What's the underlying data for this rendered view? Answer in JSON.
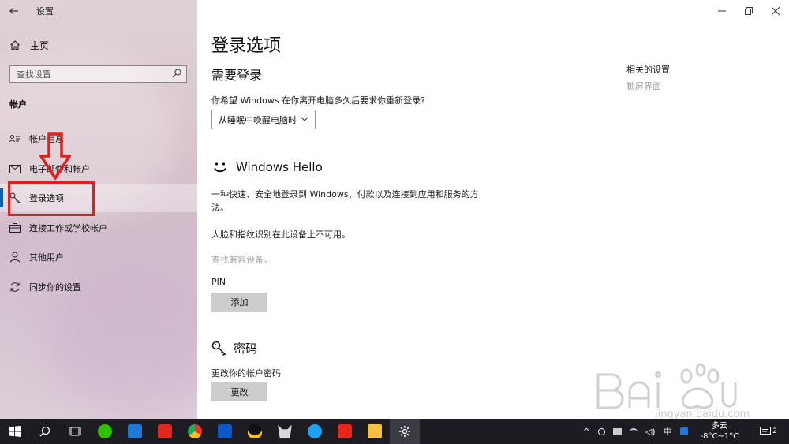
{
  "app": {
    "title": "设置"
  },
  "sidebar": {
    "home_label": "主页",
    "search_placeholder": "查找设置",
    "section": "帐户",
    "items": [
      {
        "label": "帐户信息",
        "icon": "account-info-icon"
      },
      {
        "label": "电子邮件和帐户",
        "icon": "mail-icon"
      },
      {
        "label": "登录选项",
        "icon": "key-icon",
        "active": true
      },
      {
        "label": "连接工作或学校帐户",
        "icon": "briefcase-icon"
      },
      {
        "label": "其他用户",
        "icon": "person-icon"
      },
      {
        "label": "同步你的设置",
        "icon": "sync-icon"
      }
    ]
  },
  "main": {
    "title": "登录选项",
    "require_login": {
      "heading": "需要登录",
      "question": "你希望 Windows 在你离开电脑多久后要求你重新登录?",
      "dropdown_value": "从睡眠中唤醒电脑时"
    },
    "hello": {
      "heading": "Windows Hello",
      "description": "一种快速、安全地登录到 Windows、付款以及连接到应用和服务的方法。",
      "unavailable": "人脸和指纹识别在此设备上不可用。",
      "compat_link": "查找兼容设备。"
    },
    "pin": {
      "label": "PIN",
      "button": "添加"
    },
    "password": {
      "heading": "密码",
      "subtitle": "更改你的帐户密码",
      "button": "更改"
    },
    "related": {
      "heading": "相关的设置",
      "link": "锁屏界面"
    }
  },
  "watermark": {
    "url": "jingyan.baidu.com"
  },
  "taskbar": {
    "ime": "中",
    "weather": "多云",
    "temperature": "-8°C~1°C",
    "tray_badge": "2"
  },
  "colors": {
    "accent": "#0063b1",
    "annotation": "#e41d1d",
    "taskbar": "#1c1c22"
  }
}
